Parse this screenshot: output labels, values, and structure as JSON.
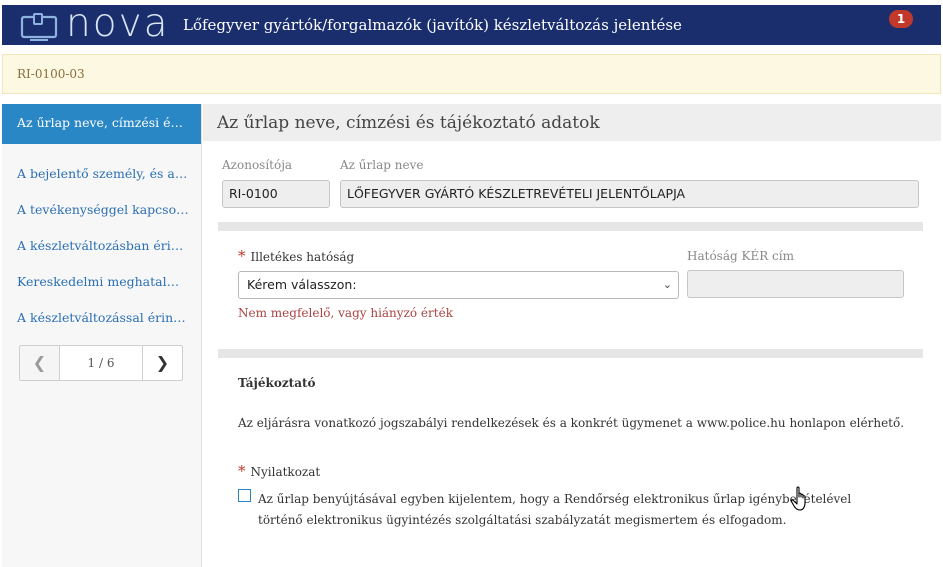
{
  "header": {
    "logo_text": "nova",
    "title": "Lőfegyver gyártók/forgalmazók (javítók) készletváltozás jelentése",
    "notification_count": "1"
  },
  "form_code": "RI-0100-03",
  "sidebar": {
    "items": [
      {
        "label": "Az űrlap neve, címzési és táj…",
        "active": true
      },
      {
        "label": "A bejelentő személy, és a bej…"
      },
      {
        "label": "A tevékenységgel kapcsolato…"
      },
      {
        "label": "A készletváltozásban érintett…"
      },
      {
        "label": "Kereskedelmi meghatalmazo…"
      },
      {
        "label": "A készletváltozással érintett …"
      }
    ],
    "pager": {
      "current": "1 / 6",
      "prev_icon": "chevron-left-icon",
      "next_icon": "chevron-right-icon"
    }
  },
  "main": {
    "section_title": "Az űrlap neve, címzési és tájékoztató adatok",
    "id_label": "Azonosítója",
    "id_value": "RI-0100",
    "name_label": "Az űrlap neve",
    "name_value": "LŐFEGYVER GYÁRTÓ KÉSZLETREVÉTELI JELENTŐLAPJA",
    "authority_label": "Illetékes hatóság",
    "authority_required": "*",
    "authority_selected": "Kérem válasszon:",
    "authority_error": "Nem megfelelő, vagy hiányzó érték",
    "ker_label": "Hatóság KÉR cím",
    "ker_value": "",
    "info_title": "Tájékoztató",
    "info_text": "Az eljárásra vonatkozó jogszabályi rendelkezések és a konkrét ügymenet a www.police.hu honlapon elérhető.",
    "declaration_label": "Nyilatkozat",
    "declaration_required": "*",
    "declaration_text": "Az űrlap benyújtásával egyben kijelentem, hogy a Rendőrség elektronikus űrlap igénybevételével történő elektronikus ügyintézés szolgáltatási szabályzatát megismertem és elfogadom.",
    "declaration_checked": false
  },
  "colors": {
    "header_bg": "#1a2e6e",
    "active_nav": "#2a87c6",
    "link": "#2a6fb3",
    "error": "#a94442",
    "badge": "#c0392b",
    "id_bar_bg": "#fdf8e2"
  }
}
